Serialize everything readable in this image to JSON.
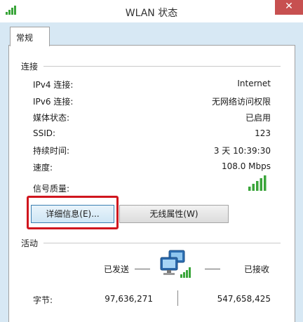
{
  "window": {
    "title": "WLAN 状态",
    "close_label": "✕"
  },
  "tabs": [
    {
      "label": "常规"
    }
  ],
  "connection": {
    "title": "连接",
    "rows": [
      {
        "label": "IPv4 连接:",
        "value": "Internet"
      },
      {
        "label": "IPv6 连接:",
        "value": "无网络访问权限"
      },
      {
        "label": "媒体状态:",
        "value": "已启用"
      },
      {
        "label": "SSID:",
        "value": "123"
      },
      {
        "label": "持续时间:",
        "value": "3 天 10:39:30"
      },
      {
        "label": "速度:",
        "value": "108.0 Mbps"
      }
    ],
    "signal_label": "信号质量:",
    "signal_bars": 5,
    "signal_max": 5
  },
  "buttons": {
    "details": "详细信息(E)...",
    "wireless_properties": "无线属性(W)"
  },
  "activity": {
    "title": "活动",
    "sent_label": "已发送",
    "received_label": "已接收",
    "bytes_label": "字节:",
    "bytes_sent": "97,636,271",
    "bytes_received": "547,658,425"
  },
  "colors": {
    "accent_border": "#d0161e",
    "signal_green": "#3aa53a",
    "chrome": "#d7e8f4",
    "close_button": "#c75050"
  },
  "icons": {
    "app": "wifi-signal-icon",
    "network": "network-computers-icon",
    "signal": "signal-strength-icon"
  }
}
